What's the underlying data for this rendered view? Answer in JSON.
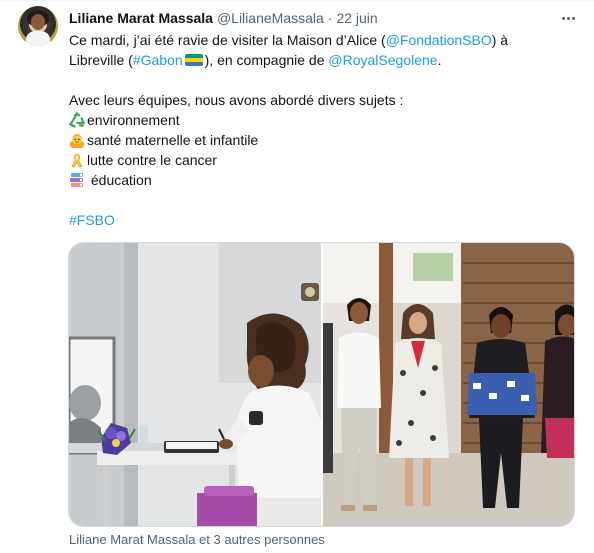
{
  "tweet": {
    "author_name": "Liliane Marat Massala",
    "author_handle": "@LilianeMassala",
    "separator": "·",
    "date": "22 juin",
    "lines": {
      "l1_a": "Ce mardi, j’ai été ravie de visiter la Maison d’Alice (",
      "l1_mention": "@FondationSBO",
      "l1_b": ") à",
      "l2_a": "Libreville (",
      "l2_hashtag": "#Gabon",
      "l2_b": "), en compagnie de ",
      "l2_mention": "@RoyalSegolene",
      "l2_c": ".",
      "l4": "Avec leurs équipes, nous avons abordé divers sujets :",
      "l5": "environnement",
      "l6": "santé maternelle et infantile",
      "l7": "lutte contre le cancer",
      "l8": " éducation",
      "l10_hashtag": "#FSBO"
    },
    "emoji_icons": [
      "recycle-icon",
      "baby-icon",
      "ribbon-icon",
      "books-icon",
      "gabon-flag-icon"
    ],
    "tagged_people": "Liliane Marat Massala et 3 autres personnes"
  },
  "colors": {
    "text": "#0f1419",
    "secondary": "#536471",
    "link": "#1d9bf0",
    "border": "#cfd9de",
    "gabon_flag": [
      "#009e60",
      "#fcd116",
      "#3a75c4"
    ]
  }
}
